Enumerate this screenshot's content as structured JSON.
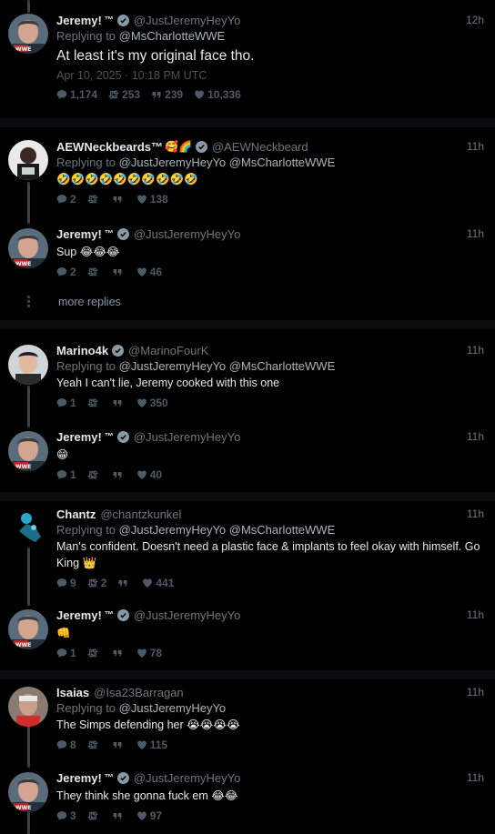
{
  "colors": {
    "background": "#000000",
    "text": "#e7e9ea",
    "muted": "#6e767d",
    "thread_line": "#3a4249"
  },
  "icons": {
    "reply": "reply-icon",
    "retweet": "retweet-icon",
    "quote": "quote-icon",
    "like": "heart-icon",
    "verified": "verified-badge-icon"
  },
  "tweets": [
    {
      "name": "Jeremy!",
      "tm": "™",
      "verified": true,
      "handle": "@JustJeremyHeyYo",
      "time": "12h",
      "reply_prefix": "Replying to",
      "reply_to": "@MsCharlotteWWE",
      "text": "At least it's my original face tho.",
      "date": "Apr 10, 2025 · 10:18 PM UTC",
      "replies": "1,174",
      "retweets": "253",
      "quotes": "239",
      "likes": "10,336"
    },
    {
      "name": "AEWNeckbeards™",
      "name_emoji": "🥰🌈",
      "verified": true,
      "handle": "@AEWNeckbeard",
      "time": "11h",
      "reply_prefix": "Replying to",
      "reply_to": "@JustJeremyHeyYo @MsCharlotteWWE",
      "text": "🤣🤣🤣🤣🤣🤣🤣🤣🤣🤣",
      "replies": "2",
      "retweets": "",
      "quotes": "",
      "likes": "138"
    },
    {
      "name": "Jeremy!",
      "tm": "™",
      "verified": true,
      "handle": "@JustJeremyHeyYo",
      "time": "11h",
      "text": "Sup 😂😂😂",
      "replies": "2",
      "retweets": "",
      "quotes": "",
      "likes": "46"
    },
    {
      "name": "Marino4k",
      "verified": true,
      "handle": "@MarinoFourK",
      "time": "11h",
      "reply_prefix": "Replying to",
      "reply_to": "@JustJeremyHeyYo @MsCharlotteWWE",
      "text": "Yeah I can't lie, Jeremy cooked with this one",
      "replies": "1",
      "retweets": "",
      "quotes": "",
      "likes": "350"
    },
    {
      "name": "Jeremy!",
      "tm": "™",
      "verified": true,
      "handle": "@JustJeremyHeyYo",
      "time": "11h",
      "text": "😁",
      "replies": "1",
      "retweets": "",
      "quotes": "",
      "likes": "40"
    },
    {
      "name": "Chantz",
      "verified": false,
      "handle": "@chantzkunkel",
      "time": "11h",
      "reply_prefix": "Replying to",
      "reply_to": "@JustJeremyHeyYo @MsCharlotteWWE",
      "text": "Man's confident. Doesn't need a plastic face & implants to feel okay with himself. Go King 👑",
      "replies": "9",
      "retweets": "2",
      "quotes": "",
      "likes": "441"
    },
    {
      "name": "Jeremy!",
      "tm": "™",
      "verified": true,
      "handle": "@JustJeremyHeyYo",
      "time": "11h",
      "text": "👊",
      "replies": "1",
      "retweets": "",
      "quotes": "",
      "likes": "78"
    },
    {
      "name": "Isaias",
      "verified": false,
      "handle": "@Isa23Barragan",
      "time": "11h",
      "reply_prefix": "Replying to",
      "reply_to": "@JustJeremyHeyYo",
      "text": "The Simps defending her 😭😭😭😭",
      "replies": "8",
      "retweets": "",
      "quotes": "",
      "likes": "115"
    },
    {
      "name": "Jeremy!",
      "tm": "™",
      "verified": true,
      "handle": "@JustJeremyHeyYo",
      "time": "11h",
      "text": "They think she gonna fuck em 😂😂",
      "replies": "3",
      "retweets": "",
      "quotes": "",
      "likes": "97"
    }
  ],
  "more_replies": "more replies"
}
